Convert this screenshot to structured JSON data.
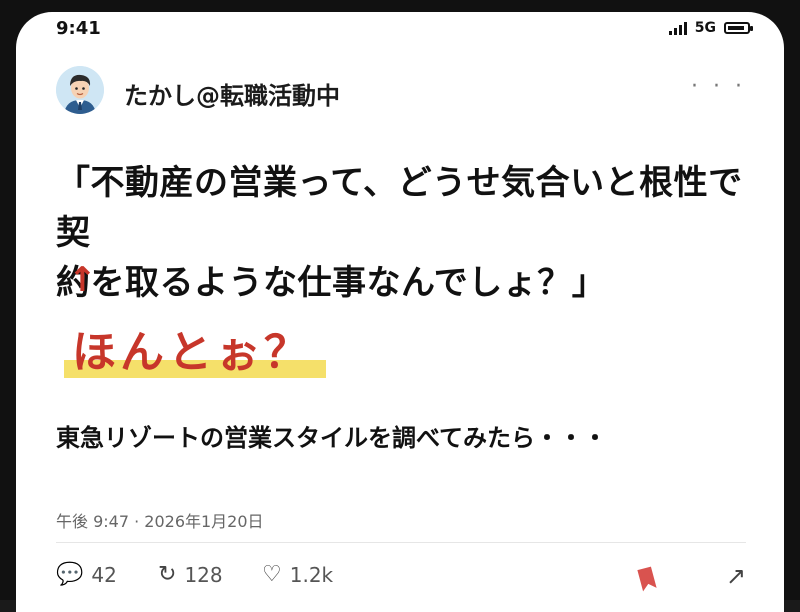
{
  "status_bar": {
    "time": "9:41",
    "network": "5G",
    "icons": [
      "signal-icon",
      "battery-icon"
    ]
  },
  "post": {
    "username": "たかし@転職活動中",
    "more_label": "· · ·",
    "quote_line1": "「不動産の営業って、どうせ気合いと根性で契",
    "quote_line2": "約を取るような仕事なんでしょ？」",
    "arrow": "↑",
    "highlight": "ほんとぉ？",
    "subline": "東急リゾートの営業スタイルを調べてみたら・・・",
    "timestamp": "午後 9:47 · 2026年1月20日"
  },
  "actions": {
    "replies": "42",
    "reposts": "128",
    "likes": "1.2k",
    "reply_icon": "💬",
    "repost_icon": "↻",
    "like_icon": "♡",
    "share_icon": "↗"
  },
  "colors": {
    "accent_red": "#c7362a",
    "highlight_yellow": "#f5e06a",
    "bookmark_red": "#d9534f"
  }
}
